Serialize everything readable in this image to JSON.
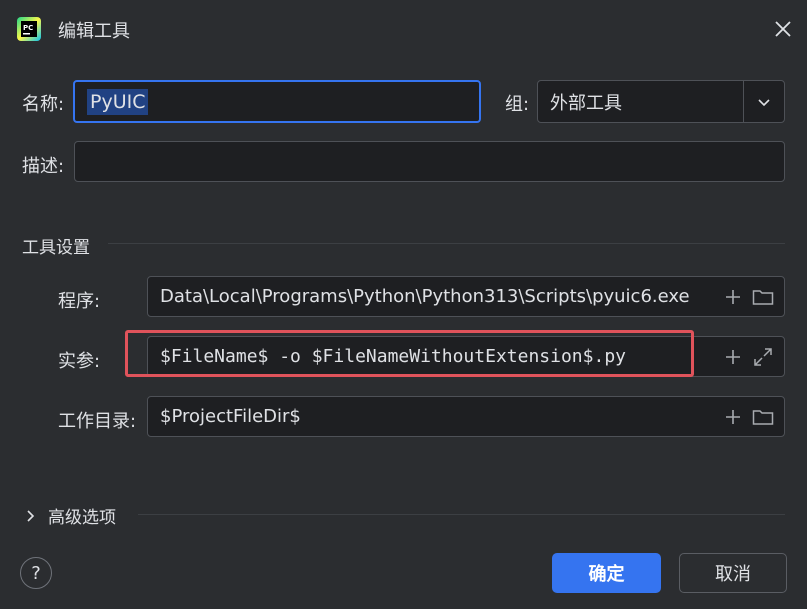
{
  "dialog": {
    "title": "编辑工具",
    "name_label": "名称:",
    "name_value": "PyUIC",
    "group_label": "组:",
    "group_value": "外部工具",
    "description_label": "描述:",
    "description_value": ""
  },
  "tool_settings": {
    "section_title": "工具设置",
    "program_label": "程序:",
    "program_value": "Data\\Local\\Programs\\Python\\Python313\\Scripts\\pyuic6.exe",
    "arguments_label": "实参:",
    "arguments_value": "$FileName$ -o $FileNameWithoutExtension$.py",
    "workdir_label": "工作目录:",
    "workdir_value": "$ProjectFileDir$"
  },
  "advanced": {
    "label": "高级选项"
  },
  "footer": {
    "help_label": "?",
    "ok_label": "确定",
    "cancel_label": "取消"
  },
  "colors": {
    "background": "#2b2d30",
    "field_bg": "#1e1f22",
    "accent": "#3574f0",
    "highlight_box": "#e0535b"
  },
  "icons": [
    "pycharm-app-icon",
    "close-icon",
    "chevron-down-icon",
    "plus-icon",
    "folder-icon",
    "expand-icon",
    "chevron-right-icon"
  ]
}
